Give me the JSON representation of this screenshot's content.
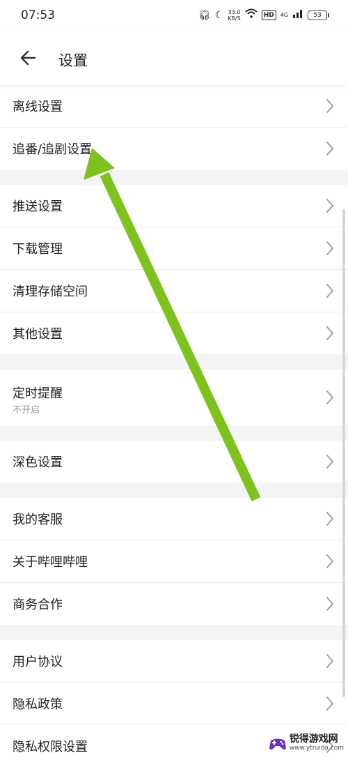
{
  "status_bar": {
    "time": "07:53",
    "speed_value": "33.0",
    "speed_unit": "KB/S",
    "hd": "HD",
    "network": "4G",
    "battery": "53"
  },
  "header": {
    "title": "设置",
    "back_icon": "arrow-left-icon"
  },
  "groups": [
    [
      {
        "label": "离线设置"
      },
      {
        "label": "追番/追剧设置"
      }
    ],
    [
      {
        "label": "推送设置"
      },
      {
        "label": "下载管理"
      },
      {
        "label": "清理存储空间"
      },
      {
        "label": "其他设置"
      }
    ],
    [
      {
        "label": "定时提醒",
        "sub": "不开启"
      }
    ],
    [
      {
        "label": "深色设置"
      }
    ],
    [
      {
        "label": "我的客服"
      },
      {
        "label": "关于哔哩哔哩"
      },
      {
        "label": "商务合作"
      }
    ],
    [
      {
        "label": "用户协议"
      },
      {
        "label": "隐私政策"
      },
      {
        "label": "隐私权限设置"
      }
    ]
  ],
  "annotation": {
    "color": "#7dc21e"
  },
  "watermark": {
    "name": "锐得游戏网",
    "url": "www.ytruida.com"
  }
}
